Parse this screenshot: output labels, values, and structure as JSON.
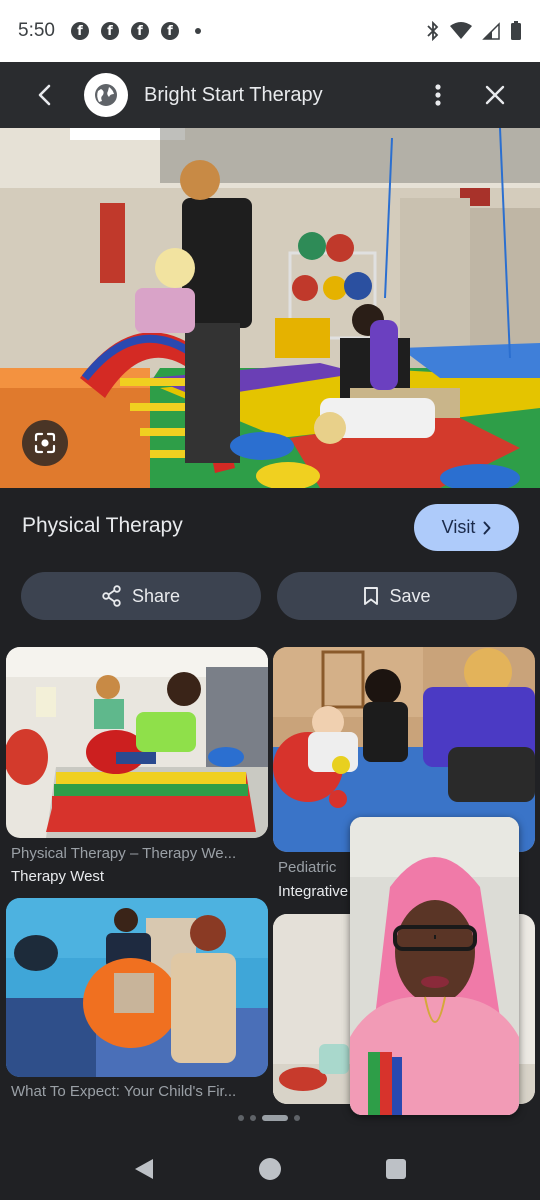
{
  "status_bar": {
    "time": "5:50",
    "notification_icons": [
      "facebook-icon",
      "facebook-icon",
      "facebook-icon",
      "facebook-icon"
    ],
    "system_icons": [
      "bluetooth-icon",
      "wifi-icon",
      "signal-icon",
      "battery-icon"
    ]
  },
  "header": {
    "site_name": "Bright Start Therapy",
    "site_icon": "globe-icon"
  },
  "result": {
    "title": "Physical Therapy",
    "visit_label": "Visit",
    "share_label": "Share",
    "save_label": "Save"
  },
  "related": [
    {
      "title": "Physical Therapy – Therapy We...",
      "source": "Therapy West"
    },
    {
      "title": "Pediatric",
      "source": "Integrative"
    },
    {
      "title": "What To Expect: Your Child's Fir...",
      "source": ""
    },
    {
      "title": "",
      "source": ""
    }
  ],
  "pager": {
    "count": 4,
    "active_index": 2
  },
  "colors": {
    "background": "#202124",
    "visit_button": "#aecbfa",
    "action_button": "#3c4350"
  }
}
